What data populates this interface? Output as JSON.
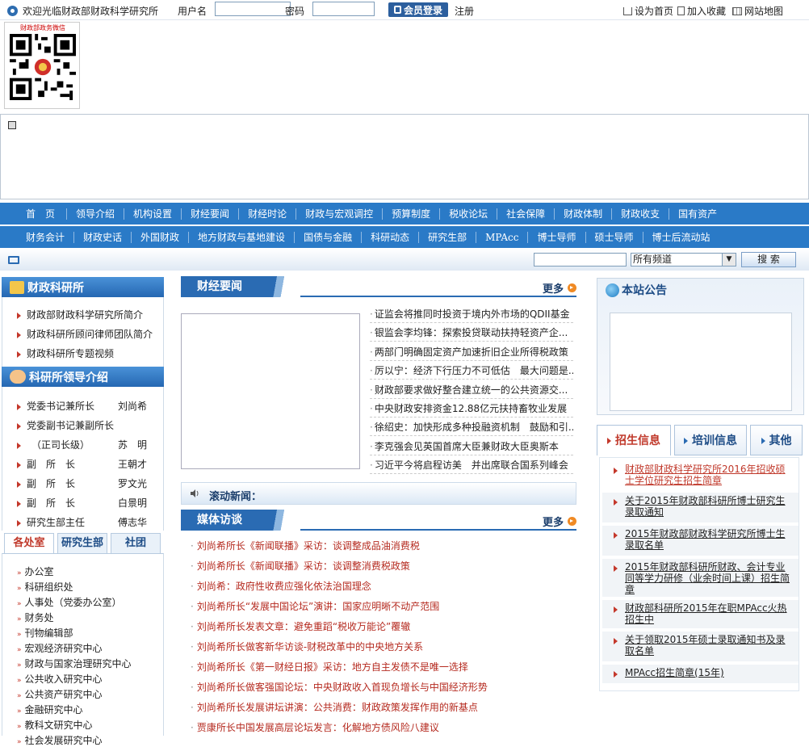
{
  "topbar": {
    "welcome": "欢迎光临财政部财政科学研究所",
    "username_label": "用户名",
    "password_label": "密码",
    "login_label": "会员登录",
    "register_label": "注册",
    "set_home": "设为首页",
    "add_fav": "加入收藏",
    "sitemap": "网站地图"
  },
  "qr": {
    "label": "财政部政务微信"
  },
  "nav1": [
    "首　页",
    "领导介绍",
    "机构设置",
    "财经要闻",
    "财经时论",
    "财政与宏观调控",
    "预算制度",
    "税收论坛",
    "社会保障",
    "财政体制",
    "财政收支",
    "国有资产"
  ],
  "nav2": [
    "财务会计",
    "财政史话",
    "外国财政",
    "地方财政与基地建设",
    "国债与金融",
    "科研动态",
    "研究生部",
    "MPAcc",
    "博士导师",
    "硕士导师",
    "博士后流动站"
  ],
  "search": {
    "channel": "所有频道",
    "button": "搜 索"
  },
  "left": {
    "section1_title": "财政科研所",
    "section1_links": [
      "财政部财政科学研究所简介",
      "财政科研所顾问律师团队简介",
      "财政科研所专题视频"
    ],
    "section2_title": "科研所领导介绍",
    "leaders": [
      {
        "title": "党委书记兼所长",
        "name": "刘尚希"
      },
      {
        "title": "党委副书记兼副所长",
        "name": ""
      },
      {
        "title": "　（正司长级）",
        "name": "苏　明"
      },
      {
        "title": "副　所　长",
        "name": "王朝才"
      },
      {
        "title": "副　所　长",
        "name": "罗文光"
      },
      {
        "title": "副　所　长",
        "name": "白景明"
      },
      {
        "title": "研究生部主任",
        "name": "傅志华"
      }
    ],
    "tabs": [
      "各处室",
      "研究生部",
      "社团"
    ],
    "depts": [
      "办公室",
      "科研组织处",
      "人事处（党委办公室）",
      "财务处",
      "刊物编辑部",
      "宏观经济研究中心",
      "财政与国家治理研究中心",
      "公共收入研究中心",
      "公共资产研究中心",
      "金融研究中心",
      "教科文研究中心",
      "社会发展研究中心"
    ]
  },
  "center": {
    "news_title": "财经要闻",
    "more": "更多",
    "news": [
      "证监会将推同时投资于境内外市场的QDII基金",
      "银监会李均锋：探索投贷联动扶持轻资产企...",
      "两部门明确固定资产加速折旧企业所得税政策",
      "厉以宁：经济下行压力不可低估　最大问题是...",
      "财政部要求做好整合建立统一的公共资源交...",
      "中央财政安排资金12.88亿元扶持畜牧业发展",
      "徐绍史：加快形成多种投融资机制　鼓励和引...",
      "李克强会见英国首席大臣兼财政大臣奥斯本",
      "习近平今将启程访美　并出席联合国系列峰会"
    ],
    "scroll_label": "滚动新闻：",
    "media_title": "媒体访谈",
    "media": [
      "刘尚希所长《新闻联播》采访：谈调整成品油消费税",
      "刘尚希所长《新闻联播》采访：谈调整消费税政策",
      "刘尚希：政府性收费应强化依法治国理念",
      "刘尚希所长“发展中国论坛”演讲：国家应明晰不动产范围",
      "刘尚希所长发表文章：避免重蹈“税收万能论”覆辙",
      "刘尚希所长做客新华访谈-财税改革中的中央地方关系",
      "刘尚希所长《第一财经日报》采访：地方自主发债不是唯一选择",
      "刘尚希所长做客强国论坛：中央财政收入首现负增长与中国经济形势",
      "刘尚希所长发展讲坛讲演：公共消费：财政政策发挥作用的新基点",
      "贾康所长中国发展高层论坛发言：化解地方债风险八建议"
    ]
  },
  "right": {
    "notice_title": "本站公告",
    "tabs": [
      "招生信息",
      "培训信息",
      "其他"
    ],
    "items": [
      "财政部财政科学研究所2016年招收硕士学位研究生招生简章",
      "关于2015年财政部科研所博士研究生录取通知",
      "2015年财政部财政科学研究所博士生录取名单",
      "2015年财政部科研所财政、会计专业同等学力研修（业余时间上课）招生简章",
      "财政部科研所2015年在职MPAcc火热招生中",
      "关于领取2015年硕士录取通知书及录取名单",
      "MPAcc招生简章(15年)"
    ]
  },
  "colors": {
    "nav_blue": "#2a7ac7",
    "accent_red": "#c0392b",
    "head_blue": "#2a6bb3"
  }
}
